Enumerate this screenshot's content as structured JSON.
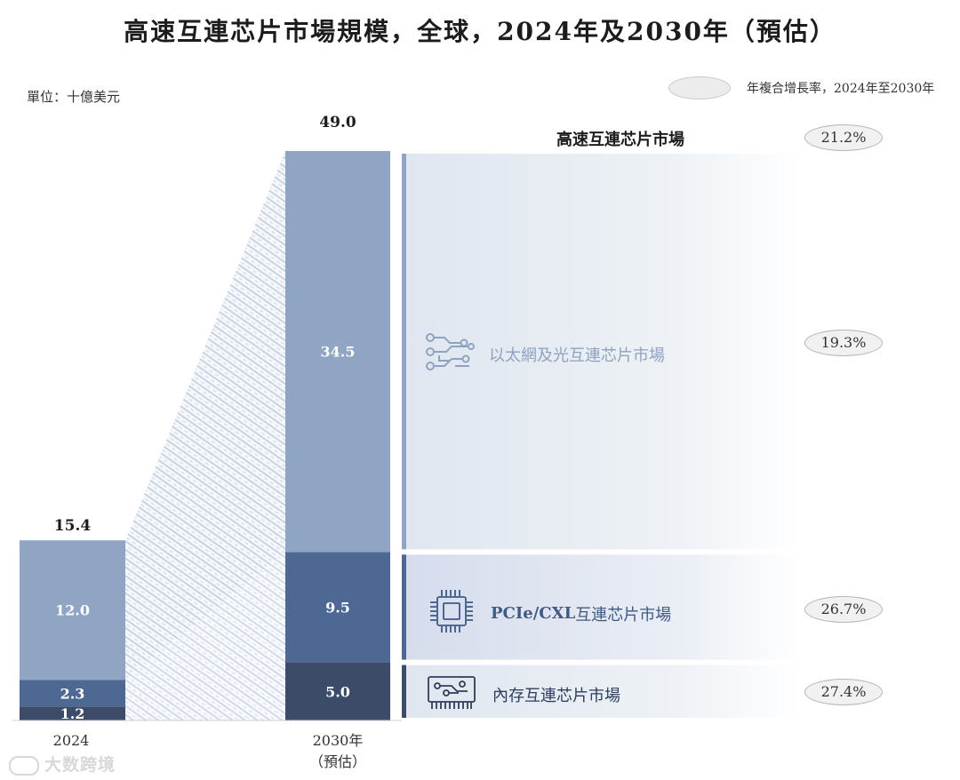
{
  "title": "高速互連芯片市場規模，全球，2024年及2030年（預估）",
  "unit_label": "單位：十億美元",
  "legend": {
    "cagr_label": "年複合增長率，2024年至2030年"
  },
  "colors": {
    "ethernet": "#8fa5c3",
    "pcie": "#4d6892",
    "memory": "#3c4b68",
    "hatch": "#b4c2d8",
    "panel": "#e6ebf2"
  },
  "chart_data": {
    "type": "bar",
    "stacked": true,
    "categories": [
      "2024",
      "2030年（預估）"
    ],
    "series": [
      {
        "name": "以太網及光互連芯片市場",
        "values": [
          12.0,
          34.5
        ],
        "cagr": "19.3%"
      },
      {
        "name": "PCIe/CXL互連芯片市場",
        "values": [
          2.3,
          9.5
        ],
        "cagr": "26.7%"
      },
      {
        "name": "內存互連芯片市場",
        "values": [
          1.2,
          5.0
        ],
        "cagr": "27.4%"
      }
    ],
    "totals": [
      15.4,
      49.0
    ],
    "total_series": {
      "name": "高速互連芯片市場",
      "cagr": "21.2%"
    },
    "value_labels": [
      [
        "12.0",
        "2.3",
        "1.2"
      ],
      [
        "34.5",
        "9.5",
        "5.0"
      ]
    ],
    "total_labels": [
      "15.4",
      "49.0"
    ],
    "ylim": [
      0,
      49.0
    ]
  },
  "xaxis": {
    "label_2024": "2024",
    "label_2030_line1": "2030年",
    "label_2030_line2": "（預估）"
  },
  "segments": {
    "total_label": "高速互連芯片市場",
    "ethernet_label": "以太網及光互連芯片市場",
    "pcie_label_bold": "PCIe/CXL",
    "pcie_label_rest": "互連芯片市場",
    "memory_label": "內存互連芯片市場",
    "icons": [
      "circuit-icon",
      "chip-icon",
      "memory-module-icon"
    ]
  },
  "watermark": "大数跨境"
}
